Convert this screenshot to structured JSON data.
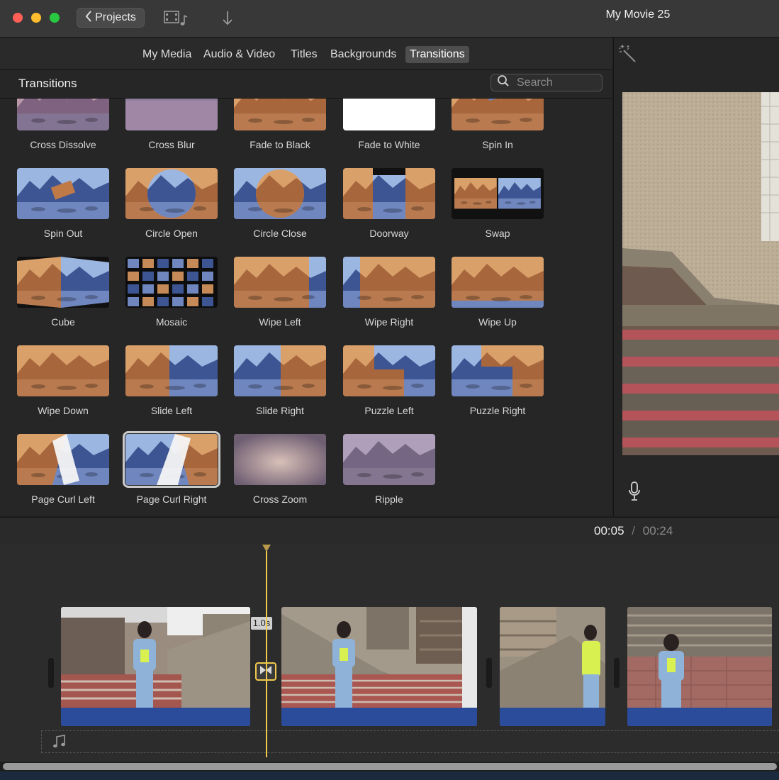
{
  "window": {
    "title": "My Movie 25",
    "back_label": "Projects"
  },
  "tabs": [
    {
      "label": "My Media",
      "active": false
    },
    {
      "label": "Audio & Video",
      "active": false
    },
    {
      "label": "Titles",
      "active": false
    },
    {
      "label": "Backgrounds",
      "active": false
    },
    {
      "label": "Transitions",
      "active": true
    }
  ],
  "panel": {
    "title": "Transitions",
    "search_placeholder": "Search"
  },
  "transitions": [
    "Cross Dissolve",
    "Cross Blur",
    "Fade to Black",
    "Fade to White",
    "Spin In",
    "Spin Out",
    "Circle Open",
    "Circle Close",
    "Doorway",
    "Swap",
    "Cube",
    "Mosaic",
    "Wipe Left",
    "Wipe Right",
    "Wipe Up",
    "Wipe Down",
    "Slide Left",
    "Slide Right",
    "Puzzle Left",
    "Puzzle Right",
    "Page Curl Left",
    "Page Curl Right",
    "Cross Zoom",
    "Ripple"
  ],
  "selected_transition": "Page Curl Right",
  "timeline": {
    "current": "00:05",
    "separator": "/",
    "total": "00:24",
    "transition_duration": "1.0s"
  },
  "colors": {
    "accent": "#f2c94c",
    "clip_audio_bar": "#2b4b9b",
    "active_tab": "#4e4e4e"
  }
}
